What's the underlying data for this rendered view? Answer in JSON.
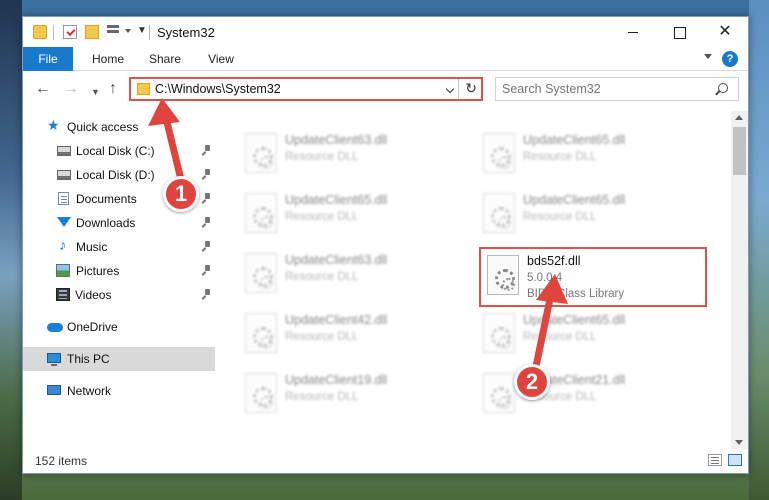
{
  "window": {
    "title": "System32",
    "tabs": [
      "File",
      "Home",
      "Share",
      "View"
    ]
  },
  "nav": {
    "address": "C:\\Windows\\System32",
    "search_placeholder": "Search System32"
  },
  "sidebar": {
    "items": [
      {
        "label": "Quick access",
        "icon": "star-icon",
        "pinned": false
      },
      {
        "label": "Local Disk (C:)",
        "icon": "disk-icon",
        "pinned": true
      },
      {
        "label": "Local Disk (D:)",
        "icon": "disk-icon",
        "pinned": true
      },
      {
        "label": "Documents",
        "icon": "documents-icon",
        "pinned": true
      },
      {
        "label": "Downloads",
        "icon": "downloads-icon",
        "pinned": true
      },
      {
        "label": "Music",
        "icon": "music-icon",
        "pinned": true
      },
      {
        "label": "Pictures",
        "icon": "pictures-icon",
        "pinned": true
      },
      {
        "label": "Videos",
        "icon": "videos-icon",
        "pinned": true
      },
      {
        "label": "OneDrive",
        "icon": "cloud-icon",
        "pinned": false
      },
      {
        "label": "This PC",
        "icon": "computer-icon",
        "pinned": false,
        "selected": true
      },
      {
        "label": "Network",
        "icon": "network-icon",
        "pinned": false
      }
    ]
  },
  "files": [
    {
      "name": "UpdateClient63.dll",
      "type": "Resource DLL"
    },
    {
      "name": "UpdateClient65.dll",
      "type": "Resource DLL"
    },
    {
      "name": "UpdateClient65.dll",
      "type": "Resource DLL"
    },
    {
      "name": "UpdateClient65.dll",
      "type": "Resource DLL"
    },
    {
      "name": "UpdateClient63.dll",
      "type": "Resource DLL"
    },
    {
      "name": "bds52f.dll",
      "type": "5.0.0.4",
      "description": "BIDS Class Library"
    },
    {
      "name": "UpdateClient42.dll",
      "type": "Resource DLL"
    },
    {
      "name": "UpdateClient65.dll",
      "type": "Resource DLL"
    },
    {
      "name": "UpdateClient19.dll",
      "type": "Resource DLL"
    },
    {
      "name": "UpdateClient21.dll",
      "type": "Resource DLL"
    }
  ],
  "status": {
    "item_count": "152 items"
  },
  "annotations": {
    "step1": "1",
    "step2": "2",
    "color": "#e0443e"
  }
}
